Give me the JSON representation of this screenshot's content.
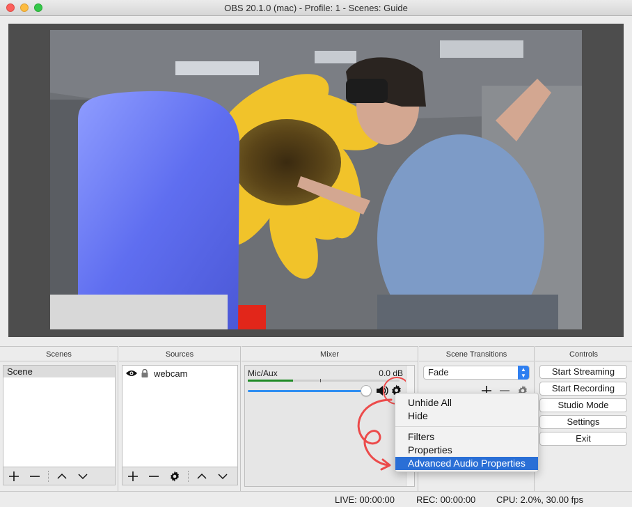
{
  "window": {
    "title": "OBS 20.1.0 (mac) - Profile: 1 - Scenes: Guide"
  },
  "docks": {
    "scenes": {
      "title": "Scenes",
      "items": [
        "Scene"
      ]
    },
    "sources": {
      "title": "Sources",
      "items": [
        {
          "label": "webcam",
          "visible_icon": "eye-icon",
          "lock_icon": "lock-icon"
        }
      ]
    },
    "mixer": {
      "title": "Mixer",
      "channel": "Mic/Aux",
      "db": "0.0 dB",
      "level": 0.3,
      "volume": 1.0
    },
    "transitions": {
      "title": "Scene Transitions",
      "selected": "Fade"
    },
    "controls": {
      "title": "Controls",
      "buttons": [
        "Start Streaming",
        "Start Recording",
        "Studio Mode",
        "Settings",
        "Exit"
      ]
    }
  },
  "context_menu": {
    "items": [
      "Unhide All",
      "Hide",
      "Filters",
      "Properties",
      "Advanced Audio Properties"
    ],
    "highlighted": "Advanced Audio Properties"
  },
  "status": {
    "live": "LIVE: 00:00:00",
    "rec": "REC: 00:00:00",
    "cpu": "CPU: 2.0%, 30.00 fps"
  },
  "colors": {
    "accent": "#2a6fd6",
    "annotation": "#ec4b4b",
    "meter": "#1f8b26"
  }
}
